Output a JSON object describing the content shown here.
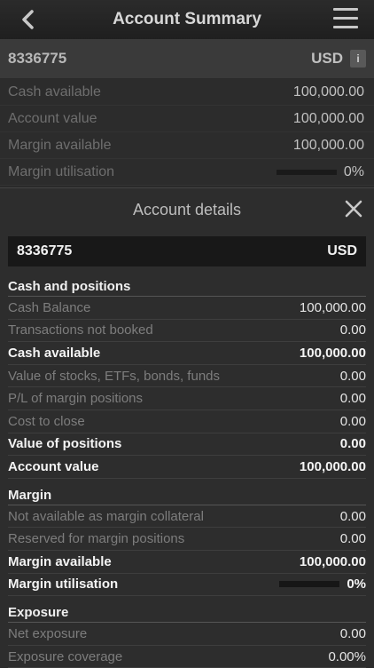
{
  "nav": {
    "title": "Account Summary"
  },
  "summary": {
    "account_number": "8336775",
    "currency": "USD",
    "info_label": "i",
    "rows": [
      {
        "label": "Cash available",
        "value": "100,000.00"
      },
      {
        "label": "Account value",
        "value": "100,000.00"
      },
      {
        "label": "Margin available",
        "value": "100,000.00"
      },
      {
        "label": "Margin utilisation",
        "value": "0%",
        "progress": 0
      }
    ]
  },
  "details": {
    "title": "Account details",
    "account_number": "8336775",
    "currency": "USD",
    "cash_positions": {
      "heading": "Cash and positions",
      "rows": [
        {
          "label": "Cash Balance",
          "value": "100,000.00"
        },
        {
          "label": "Transactions not booked",
          "value": "0.00"
        },
        {
          "label": "Cash available",
          "value": "100,000.00"
        },
        {
          "label": "Value of stocks, ETFs, bonds, funds",
          "value": "0.00"
        },
        {
          "label": "P/L of margin positions",
          "value": "0.00"
        },
        {
          "label": "Cost to close",
          "value": "0.00"
        },
        {
          "label": "Value of positions",
          "value": "0.00"
        },
        {
          "label": "Account value",
          "value": "100,000.00"
        }
      ]
    },
    "margin": {
      "heading": "Margin",
      "rows": [
        {
          "label": "Not available as margin collateral",
          "value": "0.00"
        },
        {
          "label": "Reserved for margin positions",
          "value": "0.00"
        },
        {
          "label": "Margin available",
          "value": "100,000.00"
        },
        {
          "label": "Margin utilisation",
          "value": "0%",
          "progress": 0
        }
      ]
    },
    "exposure": {
      "heading": "Exposure",
      "rows": [
        {
          "label": "Net exposure",
          "value": "0.00"
        },
        {
          "label": "Exposure coverage",
          "value": "0.00%"
        }
      ]
    }
  }
}
